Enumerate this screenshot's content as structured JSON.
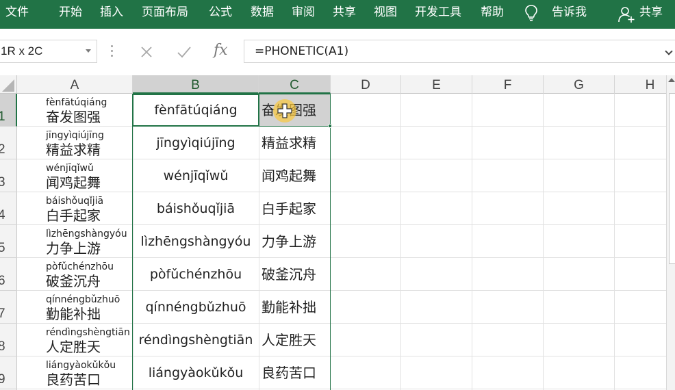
{
  "ribbon": {
    "tabs": [
      "文件",
      "开始",
      "插入",
      "页面布局",
      "公式",
      "数据",
      "审阅",
      "共享",
      "视图",
      "开发工具",
      "帮助"
    ],
    "tell_me": "告诉我",
    "share": "共享"
  },
  "formula_bar": {
    "name_box": "1R x 2C",
    "formula": "=PHONETIC(A1)",
    "fx_label": "fx"
  },
  "columns": [
    "A",
    "B",
    "C",
    "D",
    "E",
    "F",
    "G",
    "H"
  ],
  "rows": [
    {
      "num": "1",
      "pinyin": "fènfātúqiáng",
      "hanzi": "奋发图强",
      "phonetic": "fènfātúqiáng",
      "copy": "奋发图强"
    },
    {
      "num": "2",
      "pinyin": "jīngyìqiújīng",
      "hanzi": "精益求精",
      "phonetic": "jīngyìqiújīng",
      "copy": "精益求精"
    },
    {
      "num": "3",
      "pinyin": "wénjīqǐwǔ",
      "hanzi": "闻鸡起舞",
      "phonetic": "wénjīqǐwǔ",
      "copy": "闻鸡起舞"
    },
    {
      "num": "4",
      "pinyin": "báishǒuqǐjiā",
      "hanzi": "白手起家",
      "phonetic": "báishǒuqǐjiā",
      "copy": "白手起家"
    },
    {
      "num": "5",
      "pinyin": "lìzhēngshàngyóu",
      "hanzi": "力争上游",
      "phonetic": "lìzhēngshàngyóu",
      "copy": "力争上游"
    },
    {
      "num": "6",
      "pinyin": "pòfǔchénzhōu",
      "hanzi": "破釜沉舟",
      "phonetic": "pòfǔchénzhōu",
      "copy": "破釜沉舟"
    },
    {
      "num": "7",
      "pinyin": "qínnéngbǔzhuō",
      "hanzi": "勤能补拙",
      "phonetic": "qínnéngbǔzhuō",
      "copy": "勤能补拙"
    },
    {
      "num": "8",
      "pinyin": "réndìngshèngtiān",
      "hanzi": "人定胜天",
      "phonetic": "réndìngshèngtiān",
      "copy": "人定胜天"
    },
    {
      "num": "9",
      "pinyin": "liángyàokǔkǒu",
      "hanzi": "良药苦口",
      "phonetic": "liángyàokǔkǒu",
      "copy": "良药苦口"
    }
  ],
  "colors": {
    "ribbon_green": "#217346",
    "selection_border": "#217346",
    "header_bg": "#f3f3f3",
    "header_selected_bg": "#d2d2d2",
    "cursor_halo": "#fac83c"
  },
  "icons": {
    "tell_me_icon": "lightbulb-icon",
    "share_icon": "person-add-icon",
    "cancel_icon": "cross-icon",
    "enter_icon": "check-icon",
    "function_icon": "fx-icon",
    "cursor_icon": "cell-select-cursor-icon"
  }
}
